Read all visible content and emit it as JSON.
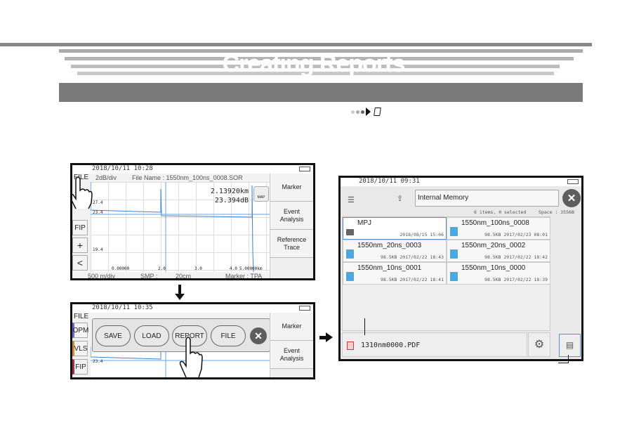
{
  "page": {
    "title": "Creating Reports"
  },
  "screen1": {
    "datetime": "2018/10/11 10:28",
    "file_tab": "FILE",
    "scale": "2dB/div",
    "file_name": "File Name : 1550nm_100ns_0008.SOR",
    "marker_distance": "2.13920km",
    "marker_loss": "23.394dB",
    "map_label": "MAP",
    "y_ticks": [
      "27.4",
      "23.4",
      "19.4"
    ],
    "x_ticks": [
      "0.00000",
      "2.0",
      "3.0",
      "4.0",
      "5.00000km"
    ],
    "bottom": {
      "div": "500 m/div",
      "smp_label": "SMP :",
      "smp_value": "20cm",
      "marker": "Marker : TPA"
    },
    "left_buttons": [
      "FIP",
      "+",
      "<"
    ],
    "side_buttons": [
      "Marker",
      "Event Analysis",
      "Reference Trace"
    ],
    "trace_color": "#3b7fd4"
  },
  "screen2": {
    "datetime": "2018/10/11 10:35",
    "file_tab": "FILE",
    "left_buttons": [
      "OPM",
      "VLS",
      "FIP"
    ],
    "menu": [
      "SAVE",
      "LOAD",
      "REPORT",
      "FILE"
    ],
    "y_tick": "23.4",
    "side_buttons": [
      "Marker",
      "Event Analysis"
    ]
  },
  "screen3": {
    "datetime": "2018/10/11 09:31",
    "location": "Internal Memory",
    "summary": "6 items, 0 selected",
    "space": "Space : 3556B",
    "files": [
      {
        "name": "MPJ",
        "meta": "2018/08/15 15:06",
        "type": "folder"
      },
      {
        "name": "1550nm_100ns_0008",
        "meta": "98.5KB 2017/02/23 08:01",
        "type": "sor"
      },
      {
        "name": "1550nm_20ns_0003",
        "meta": "98.5KB 2017/02/22 18:43",
        "type": "sor"
      },
      {
        "name": "1550nm_20ns_0002",
        "meta": "98.5KB 2017/02/22 18:42",
        "type": "sor"
      },
      {
        "name": "1550nm_10ns_0001",
        "meta": "98.5KB 2017/02/22 18:41",
        "type": "sor"
      },
      {
        "name": "1550nm_10ns_0000",
        "meta": "98.5KB 2017/02/22 18:39",
        "type": "sor"
      }
    ],
    "report_file": "1310nm0000.PDF",
    "selection_color": "#5b8fd6"
  }
}
